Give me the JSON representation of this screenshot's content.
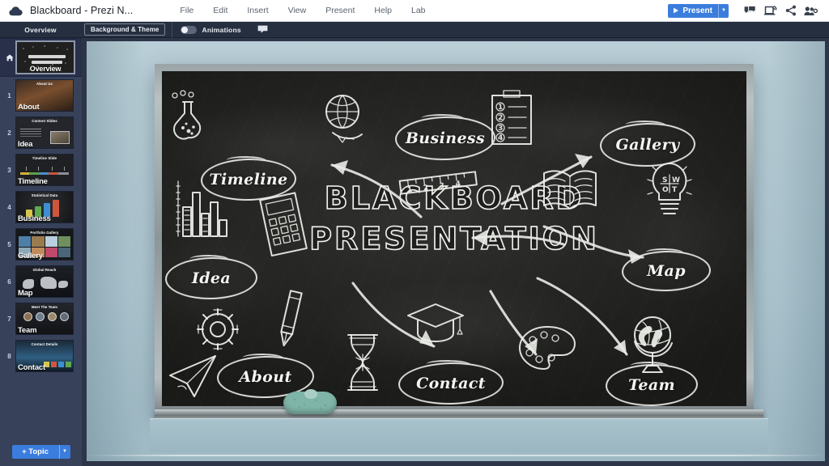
{
  "topbar": {
    "logo_icon": "prezi-cloud-icon",
    "doc_title": "Blackboard - Prezi N...",
    "menu": [
      {
        "label": "File"
      },
      {
        "label": "Edit"
      },
      {
        "label": "Insert"
      },
      {
        "label": "View"
      },
      {
        "label": "Present"
      },
      {
        "label": "Help"
      },
      {
        "label": "Lab"
      }
    ],
    "present_button": {
      "label": "Present",
      "play_icon": "play-icon",
      "caret": "▼",
      "color": "#3b7ddd"
    },
    "right_icons": [
      {
        "name": "comments-icon",
        "glyph": "comment"
      },
      {
        "name": "presenter-view-icon",
        "glyph": "screen"
      },
      {
        "name": "share-icon",
        "glyph": "share"
      },
      {
        "name": "collaborators-icon",
        "glyph": "people"
      }
    ]
  },
  "subbar": {
    "overview_tab": "Overview",
    "background_theme_button": "Background & Theme",
    "animations_toggle_label": "Animations",
    "animations_enabled": false,
    "comment_icon": "comment-icon"
  },
  "sidebar": {
    "overview": {
      "index_icon": "home-icon",
      "caption": "Overview",
      "selected": true
    },
    "slides": [
      {
        "index": "1",
        "caption": "About",
        "thumb_title": "About Us",
        "art": "about"
      },
      {
        "index": "2",
        "caption": "Idea",
        "thumb_title": "Content Slides",
        "art": "idea"
      },
      {
        "index": "3",
        "caption": "Timeline",
        "thumb_title": "Timeline Slide",
        "art": "timeline"
      },
      {
        "index": "4",
        "caption": "Business",
        "thumb_title": "Statistical Data",
        "art": "business"
      },
      {
        "index": "5",
        "caption": "Gallery",
        "thumb_title": "Portfolio Gallery",
        "art": "gallery"
      },
      {
        "index": "6",
        "caption": "Map",
        "thumb_title": "Global Reach",
        "art": "map"
      },
      {
        "index": "7",
        "caption": "Team",
        "thumb_title": "Meet The Team",
        "art": "team"
      },
      {
        "index": "8",
        "caption": "Contact",
        "thumb_title": "Contact Details",
        "art": "contact"
      }
    ],
    "add_topic_button": {
      "label": "+ Topic",
      "caret": "▼",
      "color": "#3b7ddd"
    }
  },
  "canvas": {
    "wall_color": "#aec6d0",
    "board_frame_color": "#9aa3a6",
    "board_color": "#262624",
    "chalk_color": "#ecefe9",
    "title": {
      "line1": "BLACKBOARD",
      "line2": "PRESENTATION"
    },
    "topics": [
      {
        "label": "Timeline",
        "name": "topic-bubble-timeline"
      },
      {
        "label": "Business",
        "name": "topic-bubble-business"
      },
      {
        "label": "Gallery",
        "name": "topic-bubble-gallery"
      },
      {
        "label": "Idea",
        "name": "topic-bubble-idea"
      },
      {
        "label": "Map",
        "name": "topic-bubble-map"
      },
      {
        "label": "About",
        "name": "topic-bubble-about"
      },
      {
        "label": "Contact",
        "name": "topic-bubble-contact"
      },
      {
        "label": "Team",
        "name": "topic-bubble-team"
      }
    ],
    "doodles": [
      {
        "name": "flask-icon"
      },
      {
        "name": "globe-plane-icon"
      },
      {
        "name": "checklist-icon"
      },
      {
        "name": "bar-chart-icon"
      },
      {
        "name": "ruler-icon"
      },
      {
        "name": "open-book-icon"
      },
      {
        "name": "swot-lightbulb-icon"
      },
      {
        "name": "calculator-icon"
      },
      {
        "name": "gear-icon"
      },
      {
        "name": "pencil-icon"
      },
      {
        "name": "paper-plane-icon"
      },
      {
        "name": "hourglass-icon"
      },
      {
        "name": "graduation-cap-icon"
      },
      {
        "name": "paint-palette-icon"
      },
      {
        "name": "globe-stand-icon"
      }
    ],
    "swot_letters": {
      "s": "S",
      "w": "W",
      "o": "O",
      "t": "T"
    },
    "checklist_numbers": [
      "1",
      "2",
      "3",
      "4"
    ],
    "eraser": {
      "name": "sponge-eraser",
      "color": "#7fb4a8"
    }
  }
}
